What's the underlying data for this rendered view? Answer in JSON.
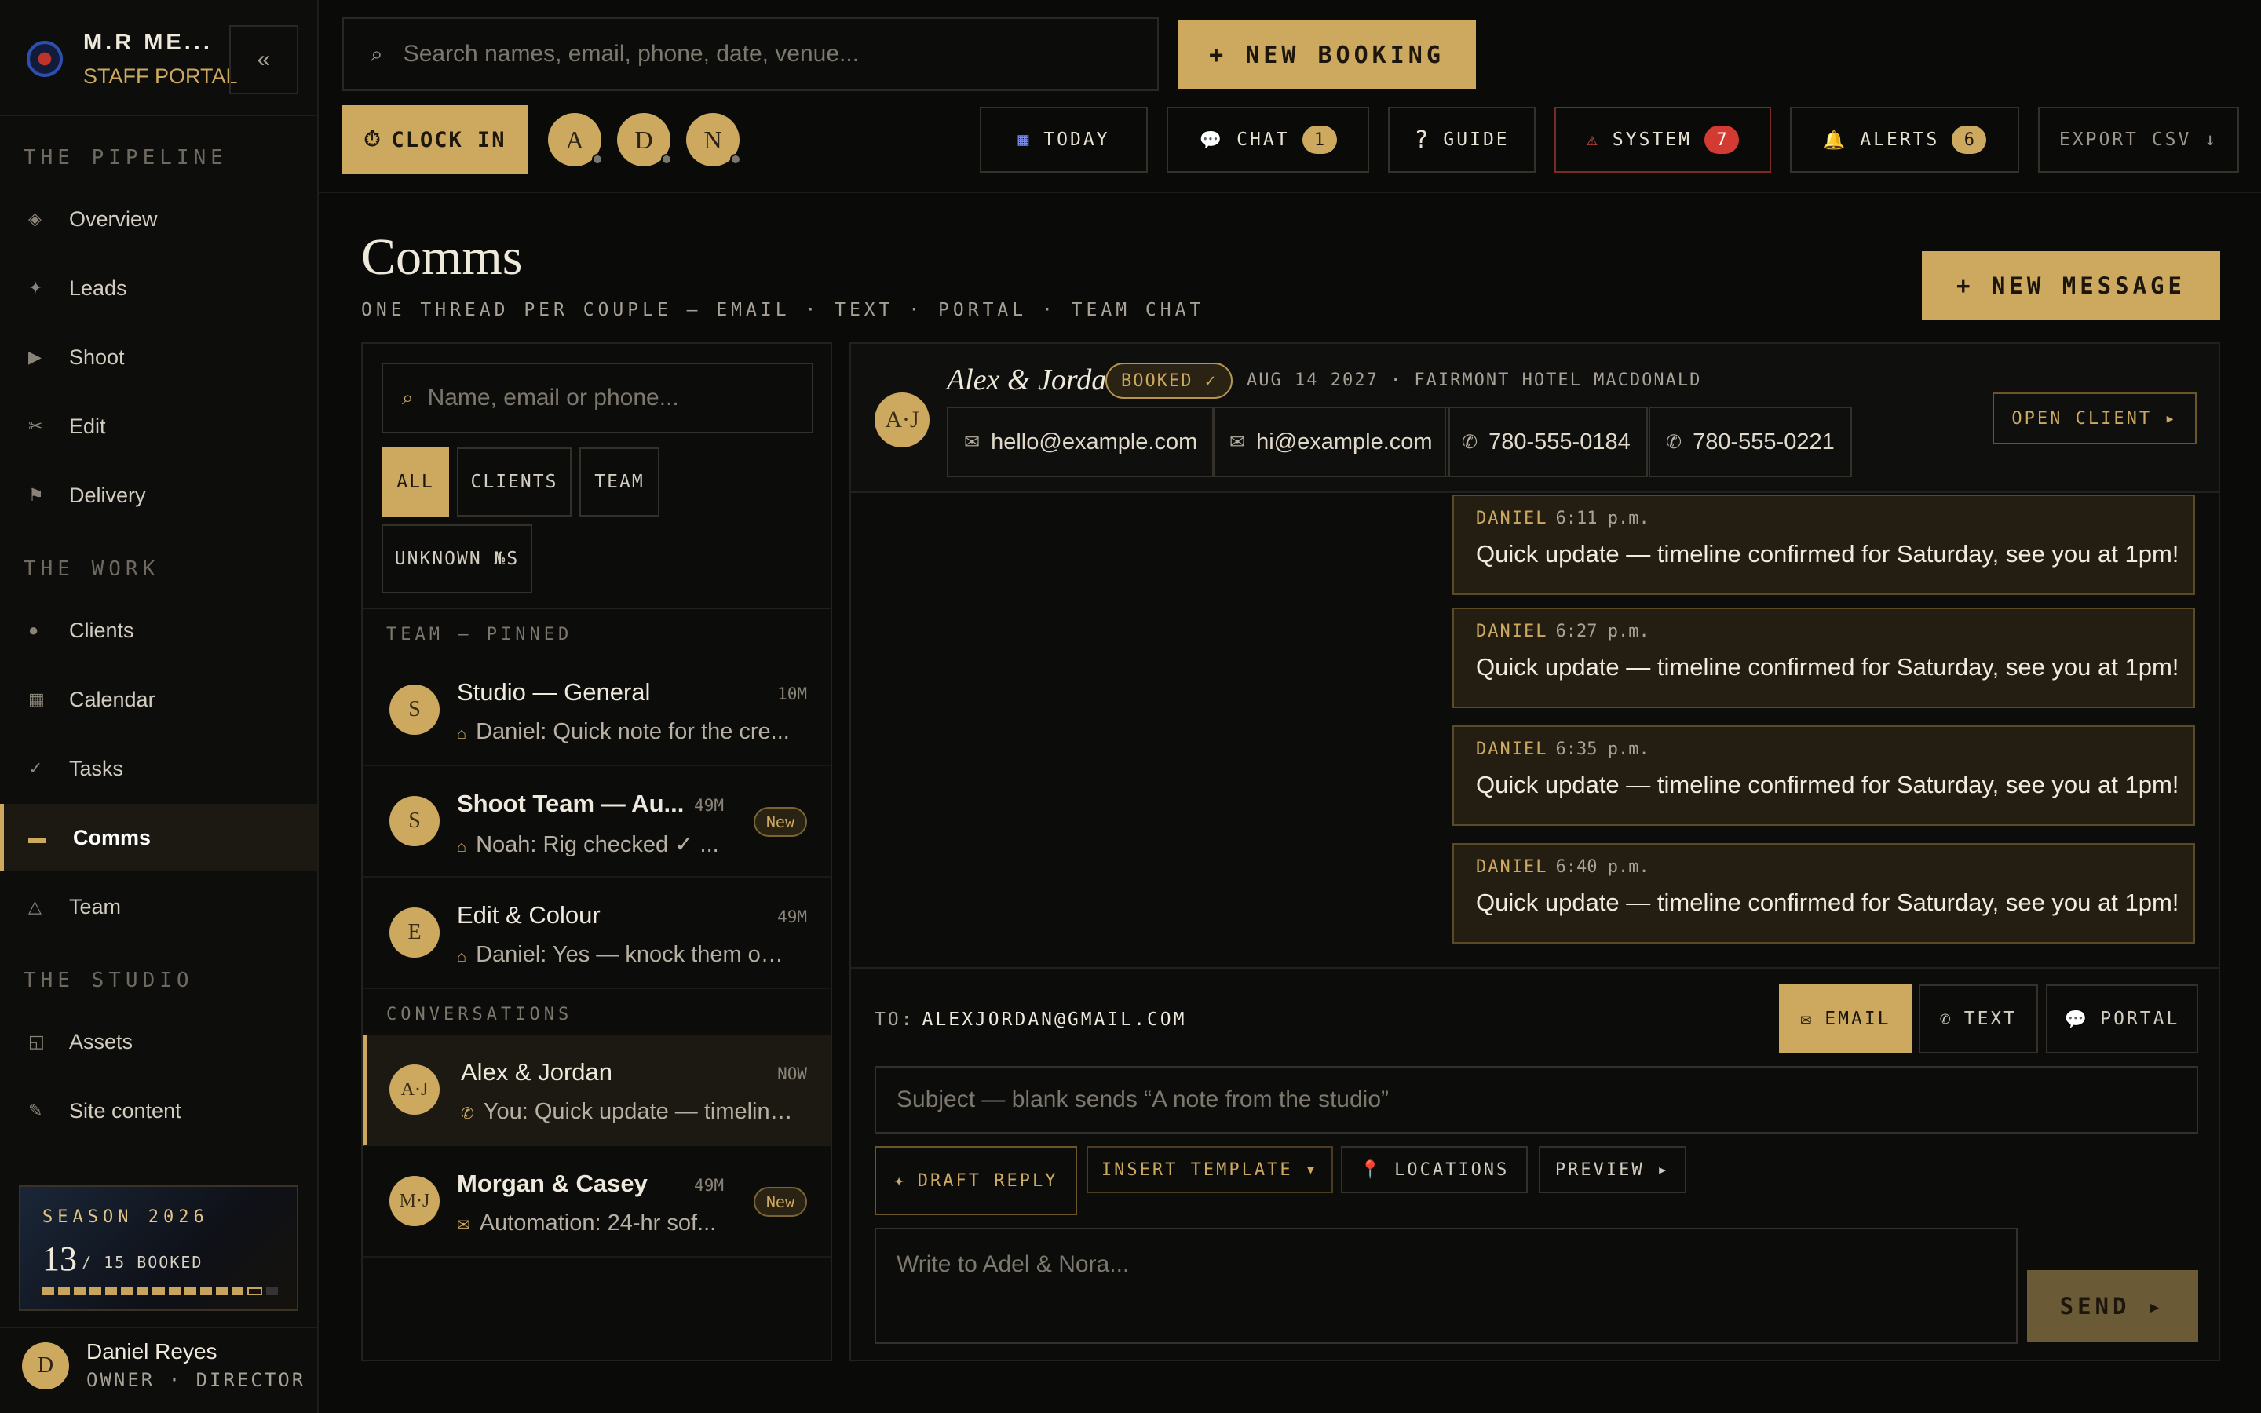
{
  "brand": {
    "title": "M.R ME...",
    "subtitle": "STAFF PORTAL",
    "collapse_icon": "«"
  },
  "sidebar": {
    "sections": [
      "THE PIPELINE",
      "THE WORK",
      "THE STUDIO"
    ],
    "items": [
      {
        "label": "Overview",
        "icon": "◈"
      },
      {
        "label": "Leads",
        "icon": "✦"
      },
      {
        "label": "Shoot",
        "icon": "▶"
      },
      {
        "label": "Edit",
        "icon": "✂"
      },
      {
        "label": "Delivery",
        "icon": "⚑"
      },
      {
        "label": "Clients",
        "icon": "●"
      },
      {
        "label": "Calendar",
        "icon": "▦"
      },
      {
        "label": "Tasks",
        "icon": "✓"
      },
      {
        "label": "Comms",
        "icon": "▬"
      },
      {
        "label": "Team",
        "icon": "△"
      },
      {
        "label": "Assets",
        "icon": "◱"
      },
      {
        "label": "Site content",
        "icon": "✎"
      }
    ]
  },
  "season": {
    "label": "SEASON 2026",
    "booked": "13",
    "of_total": "/ 15 BOOKED",
    "booked_count": 13,
    "total_count": 15
  },
  "user": {
    "initial": "D",
    "name": "Daniel Reyes",
    "role": "OWNER · DIRECTOR"
  },
  "topbar": {
    "search_placeholder": "Search names, email, phone, date, venue...",
    "new_booking": "+ NEW BOOKING",
    "clock_in": "CLOCK IN",
    "presence": [
      "A",
      "D",
      "N"
    ],
    "buttons": {
      "today": "TODAY",
      "chat": "CHAT",
      "chat_count": "1",
      "guide": "GUIDE",
      "system": "SYSTEM",
      "system_count": "7",
      "alerts": "ALERTS",
      "alerts_count": "6",
      "export": "EXPORT CSV ↓"
    }
  },
  "page": {
    "title": "Comms",
    "subtitle": "ONE THREAD PER COUPLE — EMAIL · TEXT · PORTAL · TEAM CHAT",
    "new_message": "+ NEW MESSAGE"
  },
  "threads": {
    "search_placeholder": "Name, email or phone...",
    "filters": [
      "ALL",
      "CLIENTS",
      "TEAM",
      "UNKNOWN №S"
    ],
    "team_section": "TEAM — PINNED",
    "conv_section": "CONVERSATIONS",
    "team": [
      {
        "initial": "S",
        "name": "Studio — General",
        "time": "10M",
        "preview": "Daniel: Quick note for the cre...",
        "new": ""
      },
      {
        "initial": "S",
        "name": "Shoot Team — Au...",
        "time": "49M",
        "preview": "Noah: Rig checked ✓ ...",
        "new": "New"
      },
      {
        "initial": "E",
        "name": "Edit & Colour",
        "time": "49M",
        "preview": "Daniel: Yes — knock them out ...",
        "new": ""
      }
    ],
    "conversations": [
      {
        "initial": "A·J",
        "name": "Alex & Jordan",
        "time": "NOW",
        "preview": "You: Quick update — timeline...",
        "new": ""
      },
      {
        "initial": "M·J",
        "name": "Morgan & Casey",
        "time": "49M",
        "preview": "Automation: 24-hr sof...",
        "new": "New"
      }
    ]
  },
  "conversation": {
    "initials": "A·J",
    "name": "Alex & Jordan",
    "status": "BOOKED ✓",
    "meta": "AUG 14 2027 · FAIRMONT HOTEL MACDONALD",
    "open_client": "OPEN CLIENT ▸",
    "contacts": [
      {
        "icon": "✉",
        "value": "hello@example.com"
      },
      {
        "icon": "✉",
        "value": "hi@example.com"
      },
      {
        "icon": "✆",
        "value": "780-555-0184"
      },
      {
        "icon": "✆",
        "value": "780-555-0221"
      }
    ],
    "messages": [
      {
        "author": "DANIEL",
        "time": "6:11 p.m.",
        "body": "Quick update — timeline confirmed for Saturday, see you at 1pm!"
      },
      {
        "author": "DANIEL",
        "time": "6:27 p.m.",
        "body": "Quick update — timeline confirmed for Saturday, see you at 1pm!"
      },
      {
        "author": "DANIEL",
        "time": "6:35 p.m.",
        "body": "Quick update — timeline confirmed for Saturday, see you at 1pm!"
      },
      {
        "author": "DANIEL",
        "time": "6:40 p.m.",
        "body": "Quick update — timeline confirmed for Saturday, see you at 1pm!"
      }
    ]
  },
  "composer": {
    "to_label": "TO:",
    "to_value": "ALEXJORDAN@GMAIL.COM",
    "channels": [
      {
        "icon": "✉",
        "label": "EMAIL"
      },
      {
        "icon": "✆",
        "label": "TEXT"
      },
      {
        "icon": "💬",
        "label": "PORTAL"
      }
    ],
    "subject_placeholder": "Subject — blank sends “A note from the studio”",
    "draft_reply": "DRAFT REPLY",
    "insert_template": "INSERT TEMPLATE ▾",
    "locations": "LOCATIONS",
    "preview": "PREVIEW ▸",
    "body_placeholder": "Write to Adel & Nora...",
    "send": "SEND ▸"
  },
  "colors": {
    "accent": "#cda960",
    "background": "#0a0a09",
    "alert": "#d33b32"
  }
}
